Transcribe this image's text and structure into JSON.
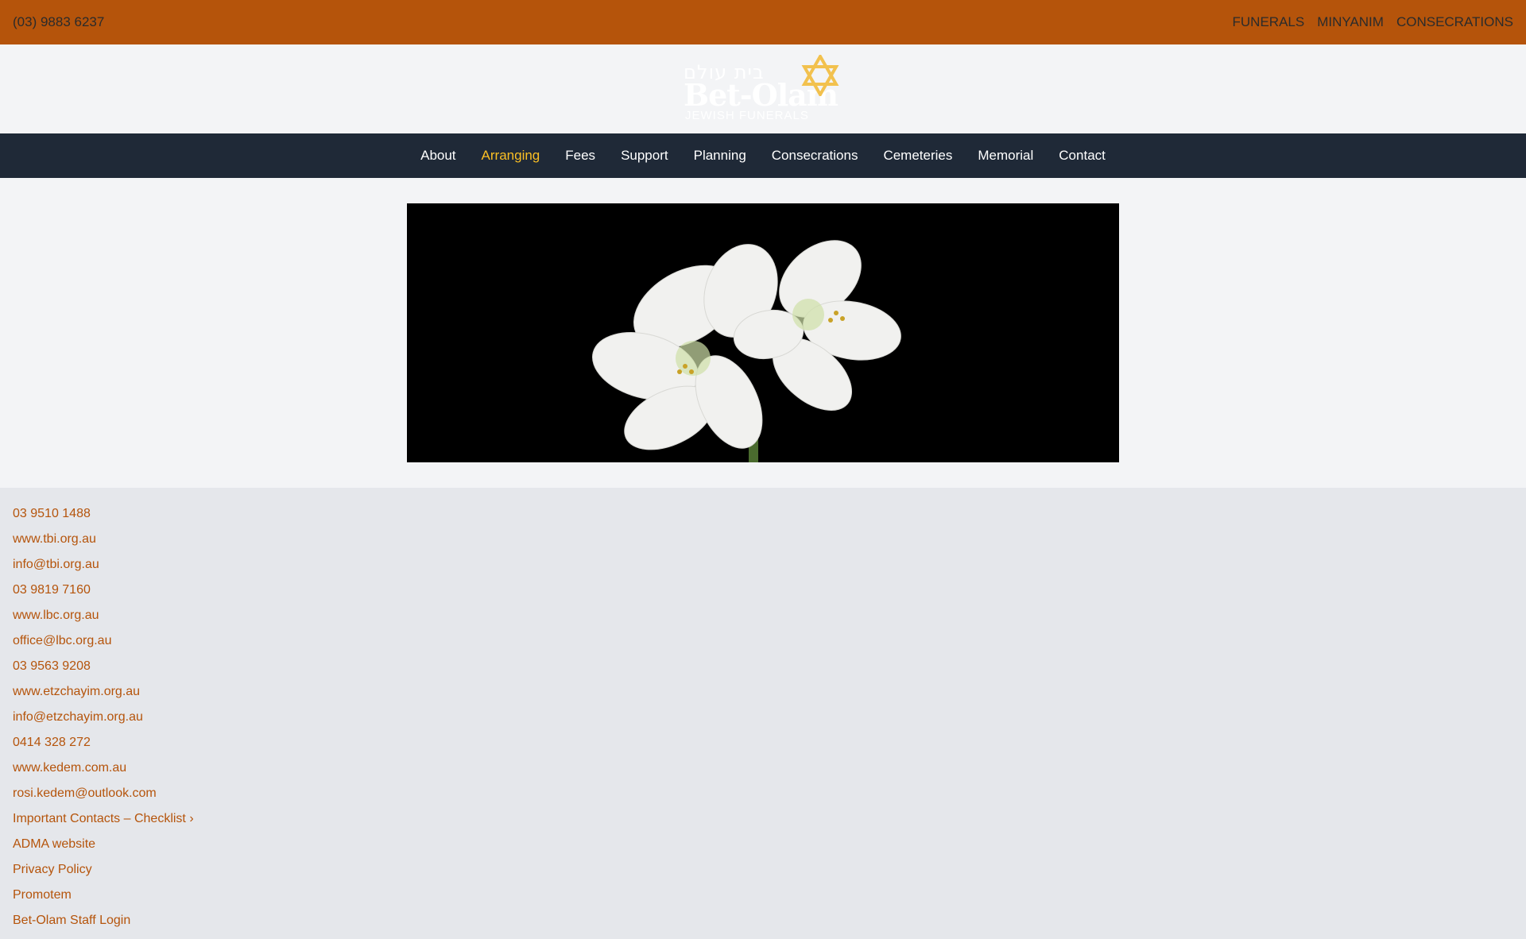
{
  "topbar": {
    "phone": "(03) 9883 6237",
    "links": [
      "FUNERALS",
      "MINYANIM",
      "CONSECRATIONS"
    ]
  },
  "logo": {
    "hebrew": "בית עולם",
    "name": "Bet-Olam",
    "subtitle": "JEWISH FUNERALS"
  },
  "nav": {
    "items": [
      "About",
      "Arranging",
      "Fees",
      "Support",
      "Planning",
      "Consecrations",
      "Cemeteries",
      "Memorial",
      "Contact"
    ],
    "active": "Arranging"
  },
  "colors": {
    "accent": "#b5540b",
    "nav_bg": "#1f2937",
    "nav_active": "#fbbf24",
    "star": "#f2c14e"
  },
  "footer": {
    "links": [
      "03 9510 1488",
      "www.tbi.org.au",
      "info@tbi.org.au",
      "03 9819 7160",
      "www.lbc.org.au",
      "office@lbc.org.au",
      "03 9563 9208",
      "www.etzchayim.org.au",
      "info@etzchayim.org.au",
      "0414 328 272",
      "www.kedem.com.au",
      "rosi.kedem@outlook.com",
      "Important Contacts – Checklist ›",
      "ADMA website",
      "Privacy Policy",
      "Promotem",
      "Bet-Olam Staff Login"
    ]
  }
}
